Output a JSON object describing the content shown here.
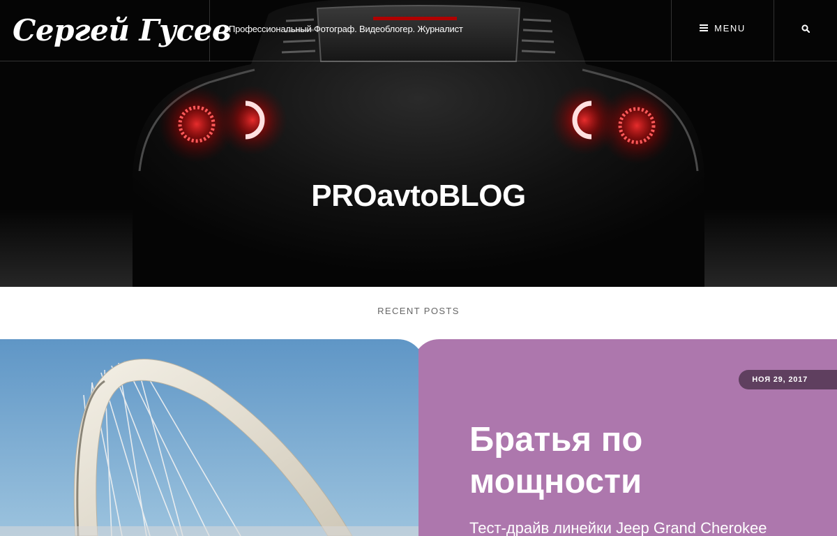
{
  "header": {
    "site_title": "Сергей Гусев",
    "tagline": "Профессиональный Фотограф. Видеоблогер. Журналист",
    "menu_label": "MENU",
    "menu_icon": "hamburger-icon",
    "search_icon": "search-icon"
  },
  "hero": {
    "title": "PROavtoBLOG"
  },
  "recent": {
    "heading": "RECENT POSTS"
  },
  "post": {
    "date": "НОЯ 29, 2017",
    "title": "Братья по мощности",
    "excerpt": "Тест-драйв линейки Jeep Grand Cherokee"
  },
  "colors": {
    "card_bg": "#ad77ad",
    "date_pill": "#5f3f5f",
    "hero_bg": "#050505"
  }
}
